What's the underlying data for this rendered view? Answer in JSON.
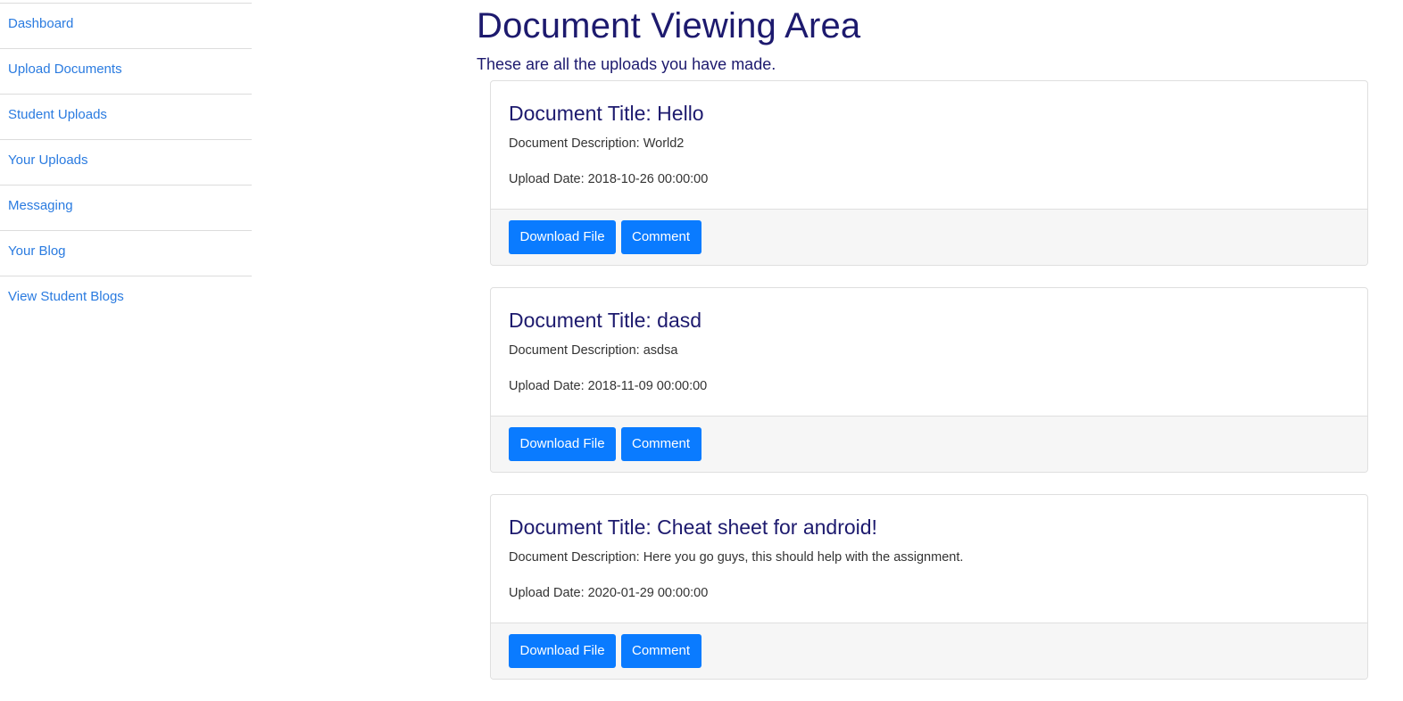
{
  "sidebar": {
    "items": [
      {
        "label": "Dashboard"
      },
      {
        "label": "Upload Documents"
      },
      {
        "label": "Student Uploads"
      },
      {
        "label": "Your Uploads"
      },
      {
        "label": "Messaging"
      },
      {
        "label": "Your Blog"
      },
      {
        "label": "View Student Blogs"
      }
    ]
  },
  "main": {
    "title": "Document Viewing Area",
    "subtitle": "These are all the uploads you have made."
  },
  "documents": [
    {
      "title": "Document Title: Hello",
      "description": "Document Description: World2",
      "upload_date": "Upload Date: 2018-10-26 00:00:00",
      "download_label": "Download File",
      "comment_label": "Comment"
    },
    {
      "title": "Document Title: dasd",
      "description": "Document Description: asdsa",
      "upload_date": "Upload Date: 2018-11-09 00:00:00",
      "download_label": "Download File",
      "comment_label": "Comment"
    },
    {
      "title": "Document Title: Cheat sheet for android!",
      "description": "Document Description: Here you go guys, this should help with the assignment.",
      "upload_date": "Upload Date: 2020-01-29 00:00:00",
      "download_label": "Download File",
      "comment_label": "Comment"
    }
  ],
  "colors": {
    "link": "#2a7be0",
    "heading": "#1d1a6e",
    "button": "#0a7bff",
    "footer_bg": "#f6f6f6"
  }
}
